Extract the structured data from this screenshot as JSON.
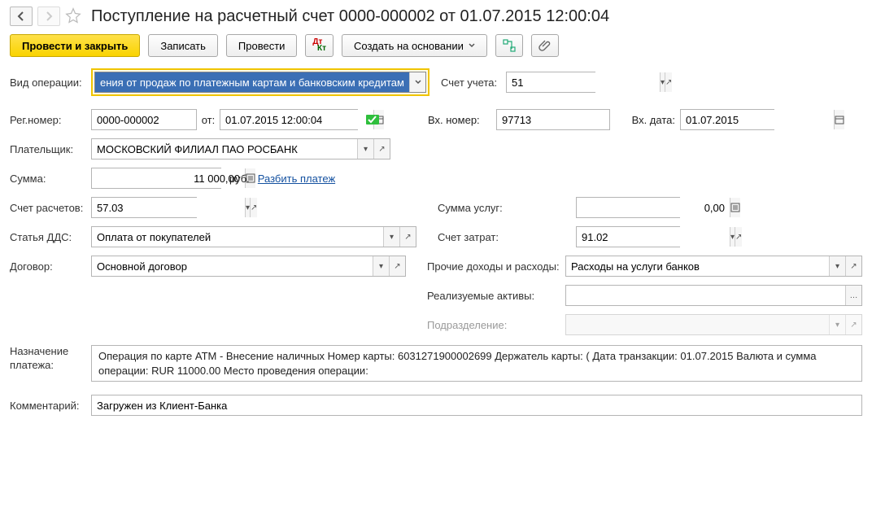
{
  "header": {
    "title": "Поступление на расчетный счет 0000-000002 от 01.07.2015 12:00:04"
  },
  "toolbar": {
    "post_close": "Провести и закрыть",
    "save": "Записать",
    "post": "Провести",
    "create_based": "Создать на основании"
  },
  "labels": {
    "op_type": "Вид операции:",
    "account": "Счет учета:",
    "reg_no": "Рег.номер:",
    "from": "от:",
    "in_no": "Вх. номер:",
    "in_date": "Вх. дата:",
    "payer": "Плательщик:",
    "sum": "Сумма:",
    "currency": "руб.",
    "split": "Разбить платеж",
    "settle_acc": "Счет расчетов:",
    "services_sum": "Сумма услуг:",
    "dds": "Статья ДДС:",
    "cost_acc": "Счет затрат:",
    "contract": "Договор:",
    "other_inc_exp": "Прочие доходы и расходы:",
    "assets": "Реализуемые активы:",
    "division": "Подразделение:",
    "purpose": "Назначение платежа:",
    "comment": "Комментарий:"
  },
  "values": {
    "op_type": "ения от продаж по платежным картам и банковским кредитам",
    "account": "51",
    "reg_no": "0000-000002",
    "date": "01.07.2015 12:00:04",
    "in_no": "97713",
    "in_date": "01.07.2015",
    "payer": "МОСКОВСКИЙ ФИЛИАЛ ПАО РОСБАНК",
    "sum": "11 000,00",
    "settle_acc": "57.03",
    "services_sum": "0,00",
    "dds": "Оплата от покупателей",
    "cost_acc": "91.02",
    "contract": "Основной договор",
    "other_inc_exp": "Расходы на услуги банков",
    "assets": "",
    "division": "",
    "purpose": "Операция по карте ATM - Внесение наличных Номер карты: 6031271900002699 Держатель карты: (                                                                   Дата транзакции: 01.07.2015 Валюта и сумма операции: RUR 11000.00 Место проведения операции:",
    "comment": "Загружен из Клиент-Банка"
  }
}
